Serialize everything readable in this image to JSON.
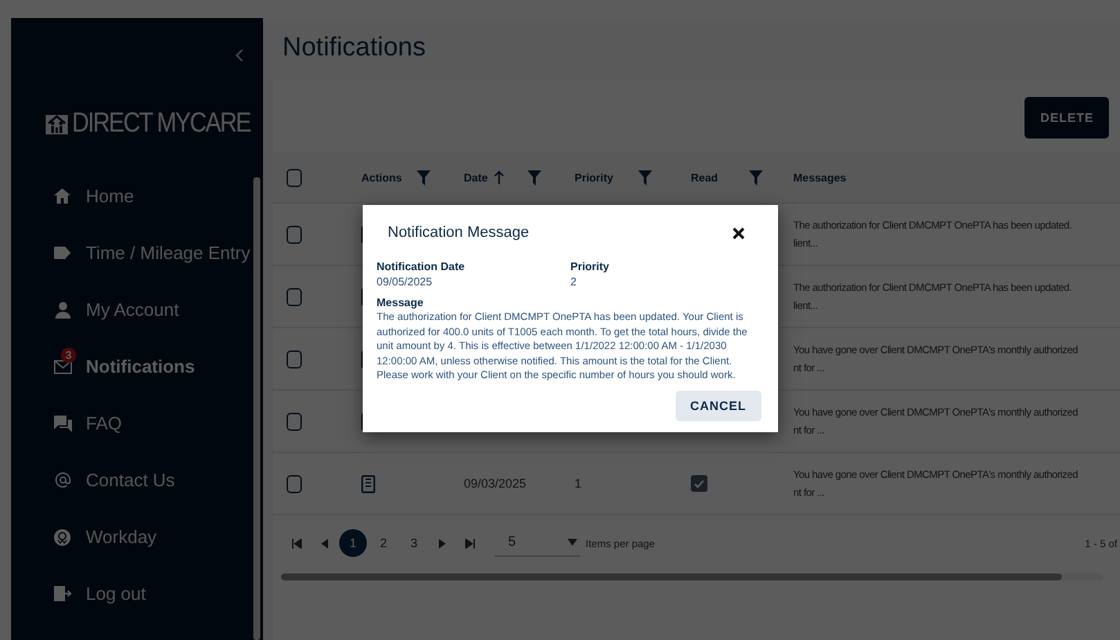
{
  "sidebar": {
    "brand": "DIRECT MYCARE",
    "items": [
      {
        "label": "Home",
        "kind": "home",
        "selected": false
      },
      {
        "label": "Time / Mileage Entry",
        "kind": "tag",
        "selected": false
      },
      {
        "label": "My Account",
        "kind": "person",
        "selected": false
      },
      {
        "label": "Notifications",
        "kind": "mail",
        "selected": true,
        "badge": "3"
      },
      {
        "label": "FAQ",
        "kind": "chat",
        "selected": false
      },
      {
        "label": "Contact Us",
        "kind": "at",
        "selected": false
      },
      {
        "label": "Workday",
        "kind": "workday",
        "selected": false
      },
      {
        "label": "Log out",
        "kind": "logout",
        "selected": false
      }
    ]
  },
  "page_title": "Notifications",
  "delete_button": "DELETE",
  "table": {
    "select_all_checked": false,
    "columns": [
      {
        "label": "Actions",
        "filter": true,
        "sorted_ascending": false
      },
      {
        "label": "Date",
        "filter": true,
        "sorted_ascending": true
      },
      {
        "label": "Priority",
        "filter": true,
        "sorted_ascending": false
      },
      {
        "label": "Read",
        "filter": true,
        "sorted_ascending": false
      },
      {
        "label": "Messages",
        "filter": false,
        "sorted_ascending": false
      }
    ],
    "rows": [
      {
        "checked": false,
        "message_lines": [
          "The authorization for Client DMCMPT OnePTA has been updated.",
          "lient..."
        ]
      },
      {
        "checked": false,
        "message_lines": [
          "The authorization for Client DMCMPT OnePTA has been updated.",
          "lient..."
        ]
      },
      {
        "checked": false,
        "message_lines": [
          "You have gone over Client DMCMPT OnePTA's monthly authorized",
          "nt for ..."
        ]
      },
      {
        "checked": false,
        "message_lines": [
          "You have gone over Client DMCMPT OnePTA's monthly authorized",
          "nt for ..."
        ]
      },
      {
        "checked": false,
        "date": "09/03/2025",
        "priority": "1",
        "read": true,
        "message_lines": [
          "You have gone over Client DMCMPT OnePTA's monthly authorized",
          "nt for ..."
        ]
      }
    ]
  },
  "pager": {
    "pages": [
      {
        "label": "1",
        "selected": true
      },
      {
        "label": "2",
        "selected": false
      },
      {
        "label": "3",
        "selected": false
      }
    ],
    "page_size": "5",
    "page_size_label": "Items per page",
    "range": "1 - 5 of"
  },
  "modal": {
    "title": "Notification Message",
    "fields": [
      {
        "label": "Notification Date",
        "value": "09/05/2025"
      },
      {
        "label": "Priority",
        "value": "2"
      }
    ],
    "message_label": "Message",
    "message": "The authorization for Client DMCMPT OnePTA has been updated. Your Client is authorized for 400.0 units of T1005 each month. To get the total hours, divide the unit amount by 4. This is effective between 1/1/2022 12:00:00 AM - 1/1/2030 12:00:00 AM, unless otherwise notified. This amount is the total for the Client. Please work with your Client on the specific number of hours you should work.",
    "cancel": "CANCEL"
  }
}
